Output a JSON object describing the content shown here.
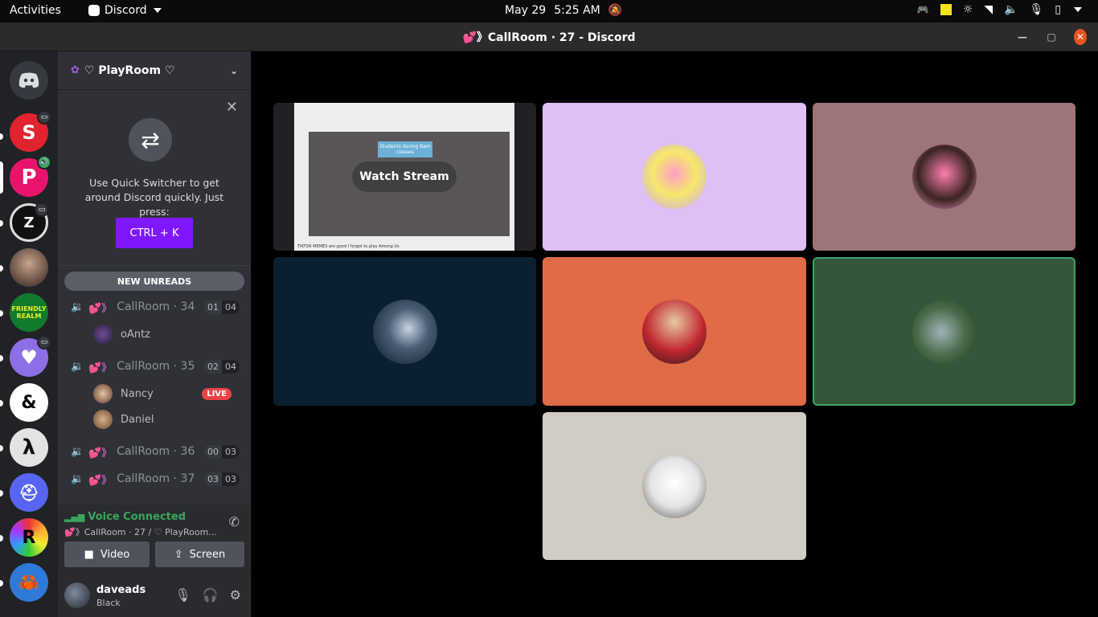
{
  "topbar": {
    "activities": "Activities",
    "app_name": "Discord",
    "date": "May 29",
    "time": "5:25 AM"
  },
  "window": {
    "title": "💕》CallRoom · 27 - Discord"
  },
  "server": {
    "name": "♡ PlayRoom ♡"
  },
  "quick_switcher": {
    "text": "Use Quick Switcher to get around Discord quickly. Just press:",
    "button": "CTRL + K"
  },
  "new_unreads": "NEW UNREADS",
  "channels": [
    {
      "name": "CallRoom · 34",
      "users": "01",
      "limit": "04"
    },
    {
      "name": "CallRoom · 35",
      "users": "02",
      "limit": "04"
    },
    {
      "name": "CallRoom · 36",
      "users": "00",
      "limit": "03"
    },
    {
      "name": "CallRoom · 37",
      "users": "03",
      "limit": "03"
    }
  ],
  "members": {
    "oantz": "oAntz",
    "nancy": "Nancy",
    "daniel": "Daniel",
    "live_badge": "LIVE"
  },
  "voice": {
    "status": "Voice Connected",
    "location": "💕》CallRoom · 27 / ♡ PlayRoom...",
    "video_label": "Video",
    "screen_label": "Screen"
  },
  "user": {
    "name": "daveads",
    "status": "Black"
  },
  "stream": {
    "watch_label": "Watch Stream",
    "caption": "Students during Bam classes",
    "footer": "TIKTOK MEMES are good I forgot to play Among Us"
  },
  "colors": {
    "tile_lavender": "#dcc0f6",
    "tile_mauve": "#9c7479",
    "tile_navy": "#0a2030",
    "tile_orange": "#e06b47",
    "tile_green": "#34573a",
    "tile_beige": "#d1cdc4",
    "speaking_border": "#3ba55d",
    "accent_purple": "#7f18ff"
  }
}
